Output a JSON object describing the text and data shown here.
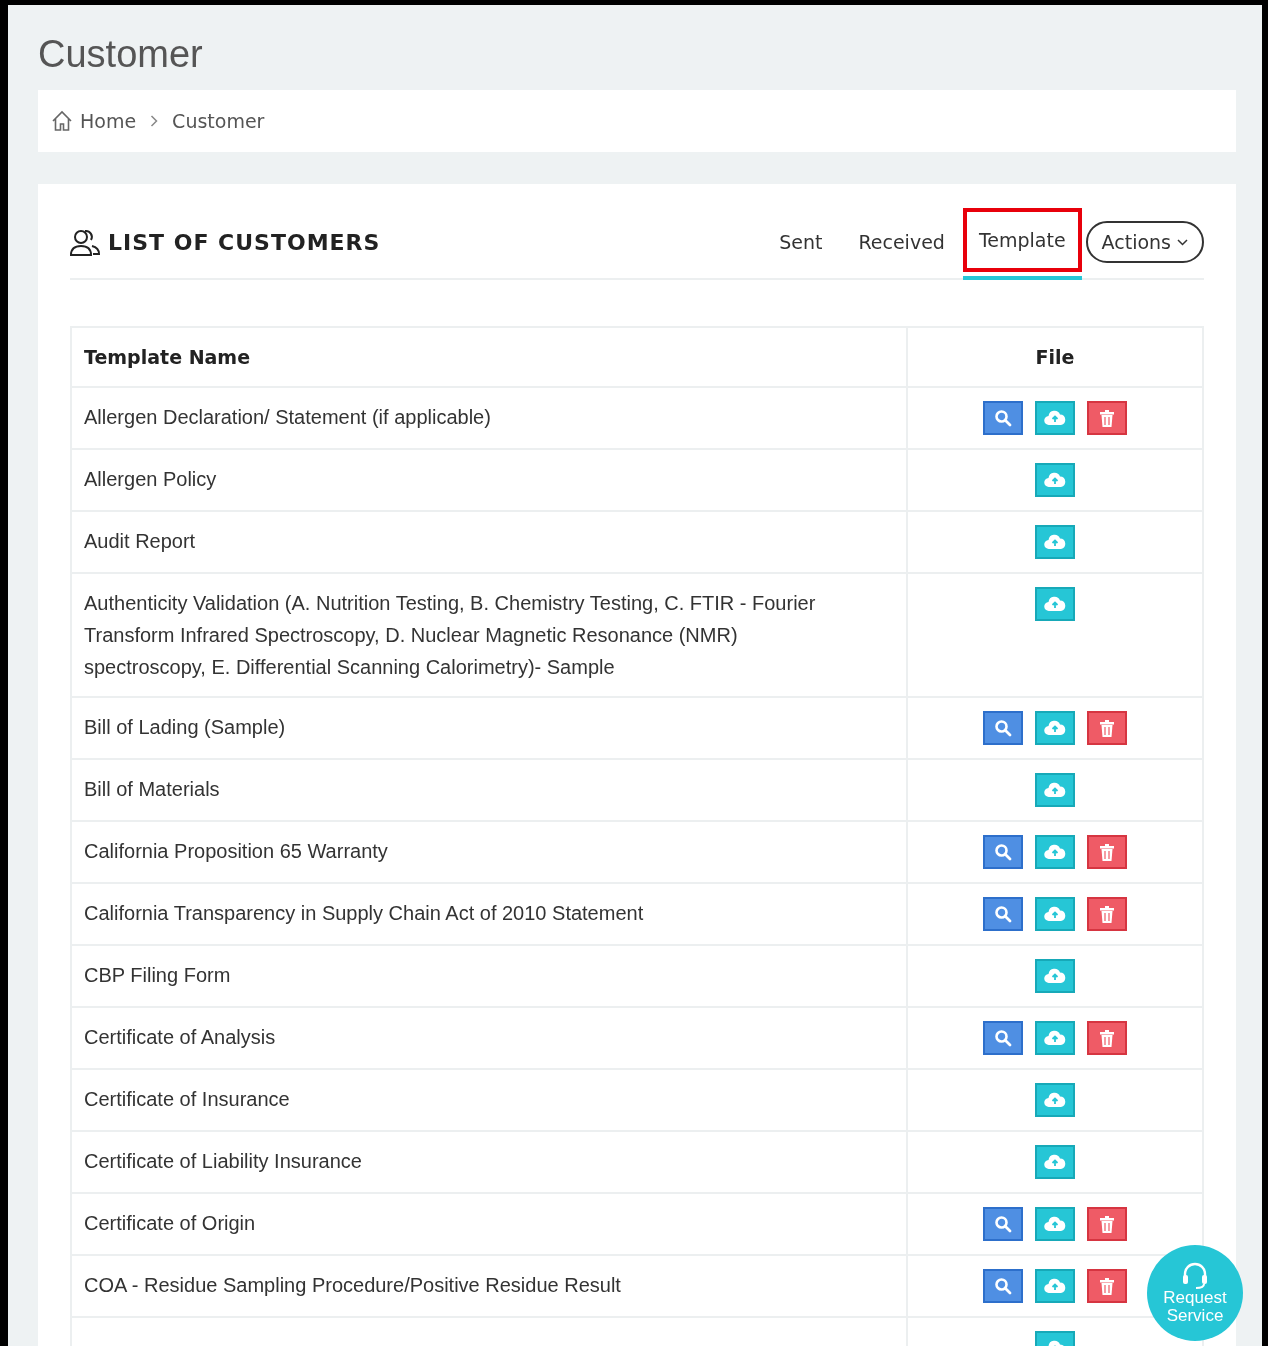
{
  "page_title": "Customer",
  "breadcrumb": [
    {
      "label": "Home",
      "kind": "home"
    },
    {
      "label": "Customer",
      "kind": "current"
    }
  ],
  "card": {
    "title": "LIST OF CUSTOMERS",
    "tabs": [
      {
        "label": "Sent",
        "selected": false,
        "highlighted": false
      },
      {
        "label": "Received",
        "selected": false,
        "highlighted": false
      },
      {
        "label": "Template",
        "selected": true,
        "highlighted": true
      }
    ],
    "actions_button": "Actions",
    "table": {
      "columns": [
        "Template Name",
        "File"
      ],
      "rows": [
        {
          "name": "Allergen Declaration/ Statement (if applicable)",
          "files": [
            {
              "kind": "view"
            },
            {
              "kind": "upload"
            },
            {
              "kind": "delete"
            }
          ]
        },
        {
          "name": "Allergen Policy",
          "files": [
            {
              "kind": "upload"
            }
          ]
        },
        {
          "name": "Audit Report",
          "files": [
            {
              "kind": "upload"
            }
          ]
        },
        {
          "name": "Authenticity Validation (A. Nutrition Testing, B. Chemistry Testing, C. FTIR - Fourier Transform Infrared Spectroscopy, D. Nuclear Magnetic Resonance (NMR) spectroscopy, E. Differential Scanning Calorimetry)- Sample",
          "files": [
            {
              "kind": "upload"
            }
          ]
        },
        {
          "name": "Bill of Lading (Sample)",
          "files": [
            {
              "kind": "view"
            },
            {
              "kind": "upload"
            },
            {
              "kind": "delete"
            }
          ]
        },
        {
          "name": "Bill of Materials",
          "files": [
            {
              "kind": "upload"
            }
          ]
        },
        {
          "name": "California Proposition 65 Warranty",
          "files": [
            {
              "kind": "view"
            },
            {
              "kind": "upload"
            },
            {
              "kind": "delete"
            }
          ]
        },
        {
          "name": "California Transparency in Supply Chain Act of 2010 Statement",
          "files": [
            {
              "kind": "view"
            },
            {
              "kind": "upload"
            },
            {
              "kind": "delete"
            }
          ]
        },
        {
          "name": "CBP Filing Form",
          "files": [
            {
              "kind": "upload"
            }
          ]
        },
        {
          "name": "Certificate of Analysis",
          "files": [
            {
              "kind": "view"
            },
            {
              "kind": "upload"
            },
            {
              "kind": "delete"
            }
          ]
        },
        {
          "name": "Certificate of Insurance",
          "files": [
            {
              "kind": "upload"
            }
          ]
        },
        {
          "name": "Certificate of Liability Insurance",
          "files": [
            {
              "kind": "upload"
            }
          ]
        },
        {
          "name": "Certificate of Origin",
          "files": [
            {
              "kind": "view"
            },
            {
              "kind": "upload"
            },
            {
              "kind": "delete"
            }
          ]
        },
        {
          "name": "COA - Residue Sampling Procedure/Positive Residue Result",
          "files": [
            {
              "kind": "view"
            },
            {
              "kind": "upload"
            },
            {
              "kind": "delete"
            }
          ]
        },
        {
          "files": [
            {
              "kind": "upload"
            }
          ]
        }
      ]
    }
  },
  "request_service": "Request Service"
}
